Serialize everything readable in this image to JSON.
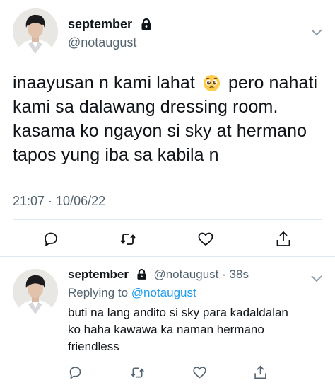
{
  "main_tweet": {
    "display_name": "september",
    "handle": "@notaugust",
    "avatar_icon": "user-avatar",
    "lock_icon": "lock-icon",
    "body_lines": [
      "inaayusan n kami lahat",
      "pero nahati",
      "kami sa dalawang dressing room.",
      "kasama ko ngayon si sky at hermano",
      "tapos yung iba sa kabila n"
    ],
    "emoji": "pleading-face-emoji",
    "timestamp": "21:07 · 10/06/22",
    "actions": [
      "reply-icon",
      "retweet-icon",
      "like-icon",
      "share-icon"
    ]
  },
  "reply_tweet": {
    "display_name": "september",
    "handle": "@notaugust",
    "separator": "·",
    "time_ago": "38s",
    "replying_label": "Replying to",
    "replying_to": "@notaugust",
    "body_lines": [
      "buti na lang andito si sky para kadaldalan",
      "ko haha kawawa ka naman hermano",
      "friendless"
    ],
    "actions": [
      "reply-icon",
      "retweet-icon",
      "like-icon",
      "share-icon"
    ]
  },
  "colors": {
    "text_primary": "#0f1419",
    "text_secondary": "#536471",
    "link": "#1d9bf0",
    "divider": "#e1e8ed"
  }
}
